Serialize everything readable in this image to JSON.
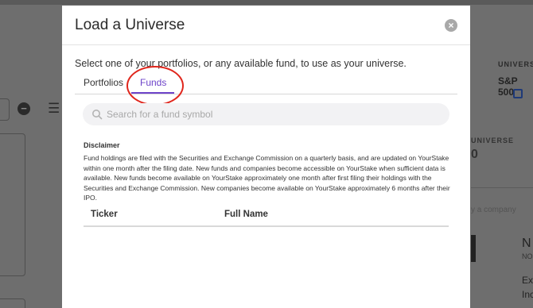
{
  "background": {
    "universe_label": "UNIVERSE",
    "universe_value": "S&P 500",
    "universe_label2": "UNIVERSE",
    "big_digit": "0",
    "faint_text": "y a company",
    "n_char": "N",
    "no_text": "NO",
    "ex_text": "Ex",
    "inc_text": "Inc",
    "minus_glyph": "−",
    "menu_glyph": "☰"
  },
  "modal": {
    "title": "Load a Universe",
    "close_glyph": "×",
    "intro": "Select one of your portfolios, or any available fund, to use as your universe.",
    "tabs": [
      {
        "label": "Portfolios",
        "active": false
      },
      {
        "label": "Funds",
        "active": true
      }
    ],
    "search": {
      "placeholder": "Search for a fund symbol",
      "value": ""
    },
    "disclaimer": {
      "title": "Disclaimer",
      "text": "Fund holdings are filed with the Securities and Exchange Commission on a quarterly basis, and are updated on YourStake within one month after the filing date. New funds and companies become accessible on YourStake when sufficient data is available. New funds become available on YourStake approximately one month after first filing their holdings with the Securities and Exchange Commission. New companies become available on YourStake approximately 6 months after their IPO."
    },
    "table": {
      "columns": [
        "Ticker",
        "Full Name"
      ],
      "rows": []
    }
  },
  "colors": {
    "accent": "#6d43c9",
    "highlight_ring": "#e0261c",
    "overlay": "#6e6e6e"
  }
}
